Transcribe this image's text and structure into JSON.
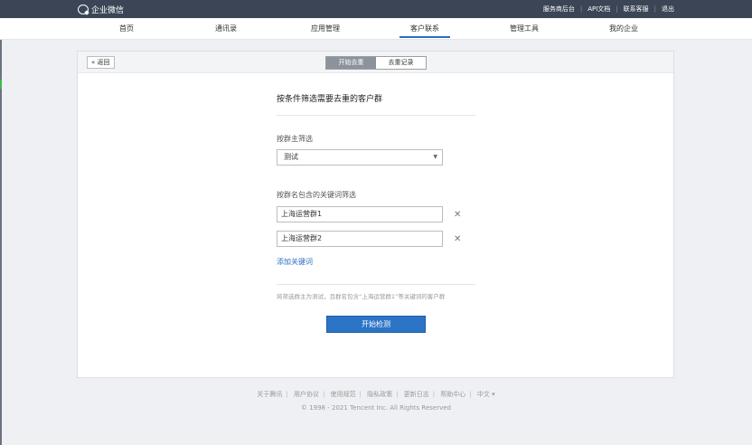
{
  "topbar": {
    "logo_text": "企业微信",
    "links": [
      "服务商后台",
      "API文档",
      "联系客服",
      "退出"
    ]
  },
  "nav": {
    "items": [
      "首页",
      "通讯录",
      "应用管理",
      "客户联系",
      "管理工具",
      "我的企业"
    ],
    "active": "客户联系"
  },
  "card": {
    "back_label": "返回",
    "tabs": [
      "开始去重",
      "去重记录"
    ],
    "form": {
      "title": "按条件筛选需要去重的客户群",
      "owner_label": "按群主筛选",
      "owner_value": "测试",
      "keyword_label": "按群名包含的关键词筛选",
      "keywords": [
        "上海运营群1",
        "上海运营群2"
      ],
      "add_keyword": "添加关键词",
      "hint": "将筛选群主为测试，且群名包含“上海运营群1”等关键词的客户群",
      "submit": "开始检测"
    }
  },
  "footer": {
    "links": [
      "关于腾讯",
      "用户协议",
      "使用规范",
      "隐私政策",
      "更新日志",
      "帮助中心",
      "中文 ▾"
    ],
    "copyright": "© 1998 - 2021 Tencent Inc. All Rights Reserved"
  },
  "colors": {
    "topbar": "#3b4556",
    "accent": "#2b74c6"
  }
}
